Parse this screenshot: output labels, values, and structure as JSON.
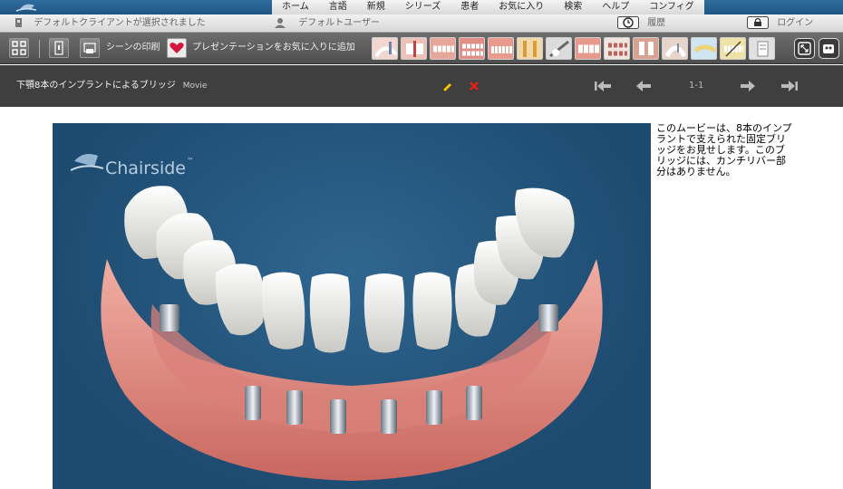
{
  "nav": {
    "items": [
      "ホーム",
      "言語",
      "新規",
      "シリーズ",
      "患者",
      "お気に入り",
      "検索",
      "ヘルプ",
      "コンフィグ"
    ]
  },
  "status": {
    "client": "デフォルトクライアントが選択されました",
    "user": "デフォルトユーザー",
    "history": "履歴",
    "login": "ログイン"
  },
  "toolbar": {
    "print_label": "シーンの印刷",
    "favorite_label": "プレゼンテーションをお気に入りに追加",
    "thumbnail_count": 15
  },
  "titlebar": {
    "title": "下顎8本のインプラントによるブリッジ",
    "type": "Movie",
    "page": "1-1"
  },
  "video": {
    "watermark": "Chairside",
    "trademark": "™"
  },
  "description": "このムービーは、8本のインプラントで支えられた固定ブリッジをお見せします。このブリッジには、カンチリバー部分はありません。",
  "colors": {
    "title_bg": "#3f3f3f",
    "toolbar_bg": "#5a5a5a",
    "video_bg": "#1f4d73",
    "gum": "#e8958a",
    "edit_icon": "#f2c500",
    "delete_icon": "#e0201b"
  }
}
